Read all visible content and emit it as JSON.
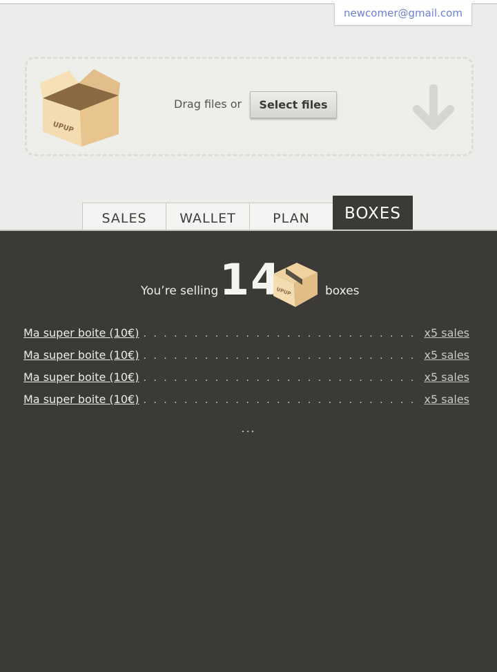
{
  "header": {
    "email": "newcomer@gmail.com"
  },
  "dropzone": {
    "drag_text": "Drag files or",
    "select_label": "Select files",
    "box_brand": "UPUP"
  },
  "tabs": [
    {
      "label": "SALES"
    },
    {
      "label": "WALLET"
    },
    {
      "label": "PLAN"
    },
    {
      "label": "BOXES"
    }
  ],
  "active_tab": "BOXES",
  "summary": {
    "prefix": "You’re selling",
    "count": "14",
    "suffix": "boxes"
  },
  "products": [
    {
      "name": "Ma super boite (10€)",
      "sales": "x5 sales"
    },
    {
      "name": "Ma super boite (10€)",
      "sales": "x5 sales"
    },
    {
      "name": "Ma super boite (10€)",
      "sales": "x5 sales"
    },
    {
      "name": "Ma super boite (10€)",
      "sales": "x5 sales"
    }
  ],
  "more_indicator": "...",
  "colors": {
    "panel": "#3b3a37",
    "email_link": "#6a7fd6",
    "page_bg": "#ececea",
    "box": "#e8c48e"
  }
}
